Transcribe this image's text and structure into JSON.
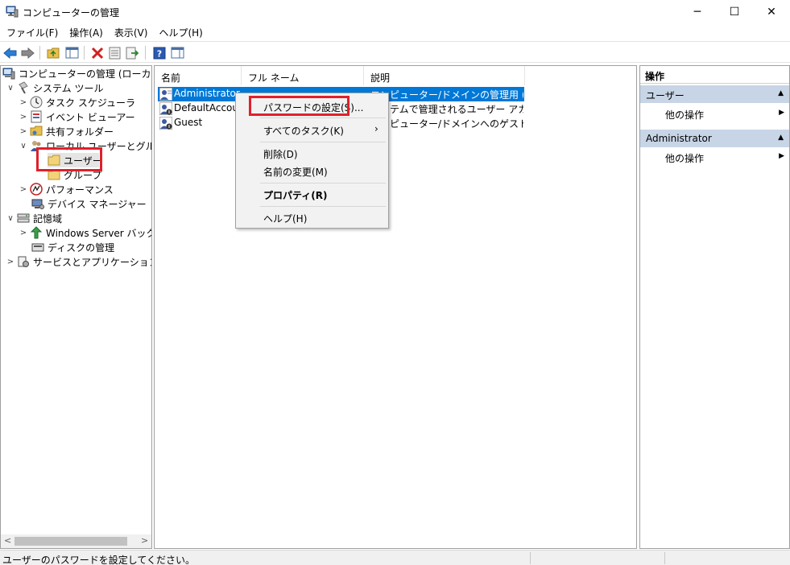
{
  "window": {
    "title": "コンピューターの管理",
    "minimize_glyph": "─",
    "maximize_glyph": "☐",
    "close_glyph": "✕"
  },
  "menubar": [
    "ファイル(F)",
    "操作(A)",
    "表示(V)",
    "ヘルプ(H)"
  ],
  "toolbar": {
    "icons": [
      "back-icon",
      "forward-icon",
      "up-folder-icon",
      "show-hide-tree-icon",
      "delete-icon",
      "properties-icon",
      "export-list-icon",
      "help-icon",
      "show-hide-action-pane-icon"
    ]
  },
  "tree": {
    "root": "コンピューターの管理 (ローカル)",
    "system_tools": "システム ツール",
    "task_scheduler": "タスク スケジューラ",
    "event_viewer": "イベント ビューアー",
    "shared_folders": "共有フォルダー",
    "local_users_groups": "ローカル ユーザーとグループ",
    "users": "ユーザー",
    "groups": "グループ",
    "performance": "パフォーマンス",
    "device_manager": "デバイス マネージャー",
    "storage": "記憶域",
    "windows_server_backup": "Windows Server バックア",
    "disk_management": "ディスクの管理",
    "services_apps": "サービスとアプリケーション"
  },
  "list": {
    "columns": [
      "名前",
      "フル ネーム",
      "説明"
    ],
    "rows": [
      {
        "name": "Administrator",
        "fullname": "",
        "description": "コンピューター/ドメインの管理用 (ビルト..."
      },
      {
        "name": "DefaultAccount",
        "fullname": "",
        "description": "システムで管理されるユーザー アカウン..."
      },
      {
        "name": "Guest",
        "fullname": "",
        "description": "コンピューター/ドメインへのゲスト アクセ..."
      }
    ]
  },
  "context_menu": {
    "set_password": "パスワードの設定(S)...",
    "all_tasks": "すべてのタスク(K)",
    "delete": "削除(D)",
    "rename": "名前の変更(M)",
    "properties": "プロパティ(R)",
    "help": "ヘルプ(H)"
  },
  "actions": {
    "title": "操作",
    "group1": "ユーザー",
    "group1_item": "他の操作",
    "group2": "Administrator",
    "group2_item": "他の操作"
  },
  "status": {
    "text": "ユーザーのパスワードを設定してください。"
  },
  "colors": {
    "selection": "#0078d7",
    "highlight_box": "#e0202a",
    "action_group_bg": "#c7d5e6"
  }
}
